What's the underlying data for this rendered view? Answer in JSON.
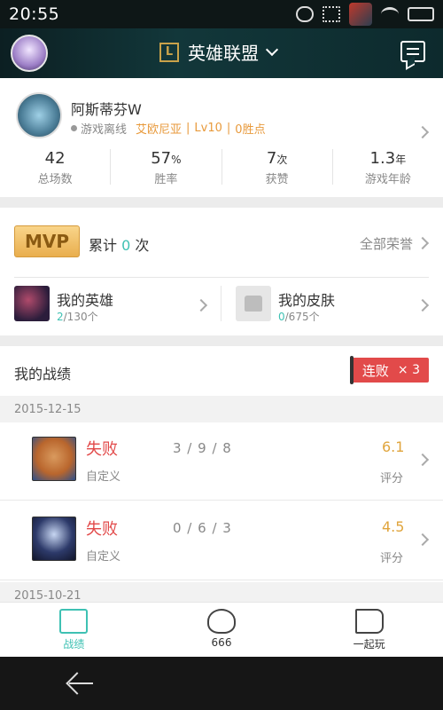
{
  "status_bar": {
    "time": "20:55"
  },
  "header": {
    "game_name": "英雄联盟",
    "game_logo_letter": "L"
  },
  "profile": {
    "name": "阿斯蒂芬W",
    "status": "游戏离线",
    "server": "艾欧尼亚",
    "level": "Lv10",
    "wins": "0胜点",
    "stats": [
      {
        "value": "42",
        "unit": "",
        "label": "总场数"
      },
      {
        "value": "57",
        "unit": "%",
        "label": "胜率"
      },
      {
        "value": "7",
        "unit": "次",
        "label": "获赞"
      },
      {
        "value": "1.3",
        "unit": "年",
        "label": "游戏年龄"
      }
    ]
  },
  "honor": {
    "mvp_badge": "MVP",
    "cumulative_prefix": "累计",
    "cumulative_count": "0",
    "cumulative_suffix": "次",
    "all_honors": "全部荣誉",
    "heroes": {
      "title": "我的英雄",
      "owned": "2",
      "total": "/130个"
    },
    "skins": {
      "title": "我的皮肤",
      "owned": "0",
      "total": "/675个"
    }
  },
  "records": {
    "title": "我的战绩",
    "streak_label": "连败",
    "streak_mult": "× 3",
    "groups": [
      {
        "date": "2015-12-15",
        "matches": [
          {
            "result": "失败",
            "kda": "3 / 9 / 8",
            "mode": "自定义",
            "score": "6.1",
            "score_label": "评分",
            "color": "#b9662d"
          },
          {
            "result": "失败",
            "kda": "0 / 6 / 3",
            "mode": "自定义",
            "score": "4.5",
            "score_label": "评分",
            "color": "#2d3a6a"
          }
        ]
      },
      {
        "date": "2015-10-21"
      }
    ]
  },
  "tabs": [
    {
      "label": "战绩",
      "active": true
    },
    {
      "label": "666",
      "active": false
    },
    {
      "label": "一起玩",
      "active": false
    }
  ]
}
